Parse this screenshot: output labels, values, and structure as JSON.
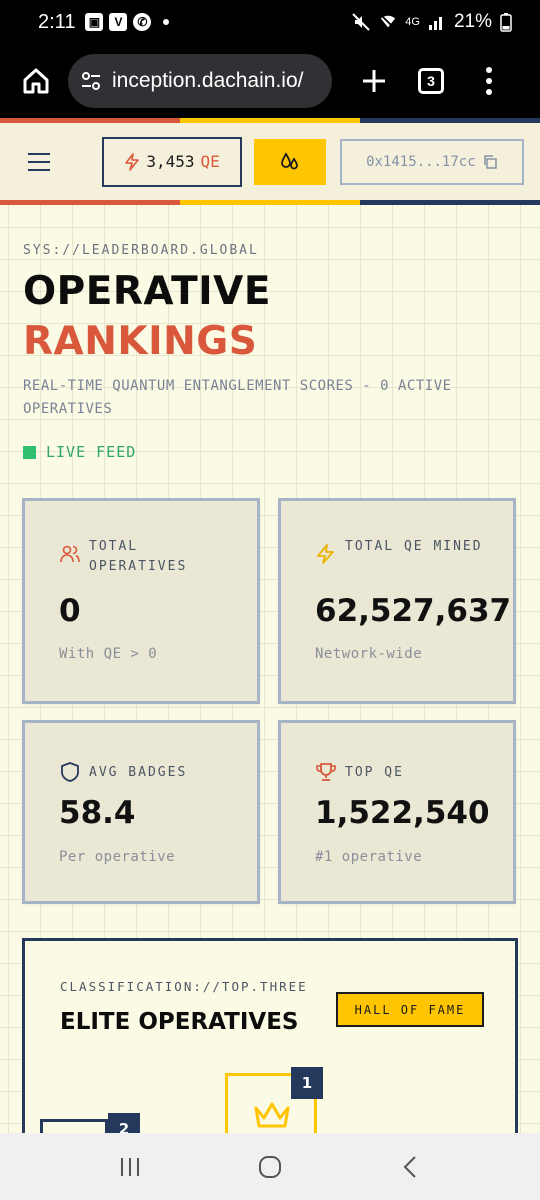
{
  "status_bar": {
    "time": "2:11",
    "notif_icons": [
      "image-icon",
      "v-app-icon",
      "whatsapp-icon"
    ],
    "network": "4G",
    "battery": "21%"
  },
  "browser": {
    "url": "inception.dachain.io/",
    "tab_count": "3"
  },
  "header": {
    "qe_balance": "3,453",
    "qe_unit": "QE",
    "wallet": "0x1415...17cc"
  },
  "hero": {
    "sys_path": "SYS://LEADERBOARD.GLOBAL",
    "title_line1": "OPERATIVE",
    "title_line2": "RANKINGS",
    "subtitle": "REAL-TIME QUANTUM ENTANGLEMENT SCORES - 0 ACTIVE OPERATIVES",
    "live_label": "LIVE FEED"
  },
  "stats": [
    {
      "label": "TOTAL OPERATIVES",
      "value": "0",
      "note": "With QE > 0",
      "icon": "users-icon"
    },
    {
      "label": "TOTAL QE MINED",
      "value": "62,527,637",
      "note": "Network-wide",
      "icon": "lightning-icon"
    },
    {
      "label": "AVG BADGES",
      "value": "58.4",
      "note": "Per operative",
      "icon": "shield-icon"
    },
    {
      "label": "TOP QE",
      "value": "1,522,540",
      "note": "#1 operative",
      "icon": "trophy-icon"
    }
  ],
  "elite": {
    "classification": "CLASSIFICATION://TOP.THREE",
    "title": "ELITE OPERATIVES",
    "badge": "HALL OF FAME",
    "rank1": "1",
    "rank2": "2"
  },
  "colors": {
    "accent_orange": "#d9583b",
    "accent_yellow": "#ffc501",
    "navy": "#24395b",
    "live_green": "#2fbf71"
  }
}
